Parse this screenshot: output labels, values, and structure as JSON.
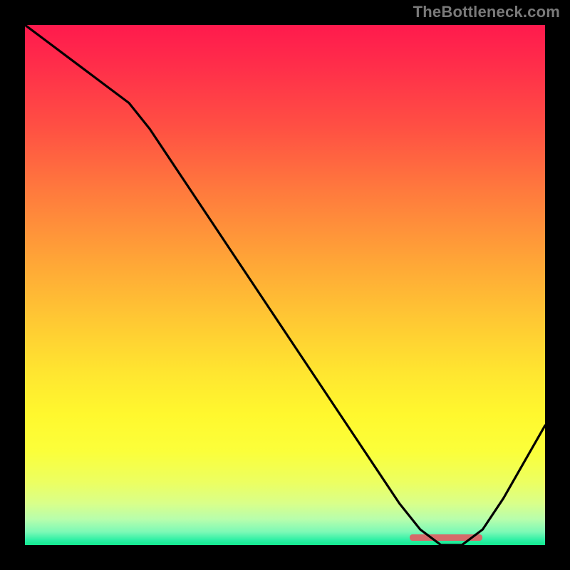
{
  "attribution": "TheBottleneck.com",
  "chart_data": {
    "type": "line",
    "title": "",
    "xlabel": "",
    "ylabel": "",
    "xlim": [
      0,
      100
    ],
    "ylim": [
      0,
      100
    ],
    "x": [
      0,
      4,
      8,
      12,
      16,
      20,
      24,
      28,
      32,
      36,
      40,
      44,
      48,
      52,
      56,
      60,
      64,
      68,
      72,
      76,
      80,
      84,
      88,
      92,
      96,
      100
    ],
    "values": [
      100,
      97,
      94,
      91,
      88,
      85,
      80,
      74,
      68,
      62,
      56,
      50,
      44,
      38,
      32,
      26,
      20,
      14,
      8,
      3,
      0,
      0,
      3,
      9,
      16,
      23
    ],
    "optimum_range": {
      "start": 74,
      "end": 88
    },
    "gradient_stops": [
      {
        "pos": 0.0,
        "color": "#ff1a4d"
      },
      {
        "pos": 0.5,
        "color": "#ffc933"
      },
      {
        "pos": 0.8,
        "color": "#fff82e"
      },
      {
        "pos": 1.0,
        "color": "#13e98f"
      }
    ]
  },
  "colors": {
    "line": "#000000",
    "marker": "#d66a6a",
    "frame_bg": "#000000"
  }
}
